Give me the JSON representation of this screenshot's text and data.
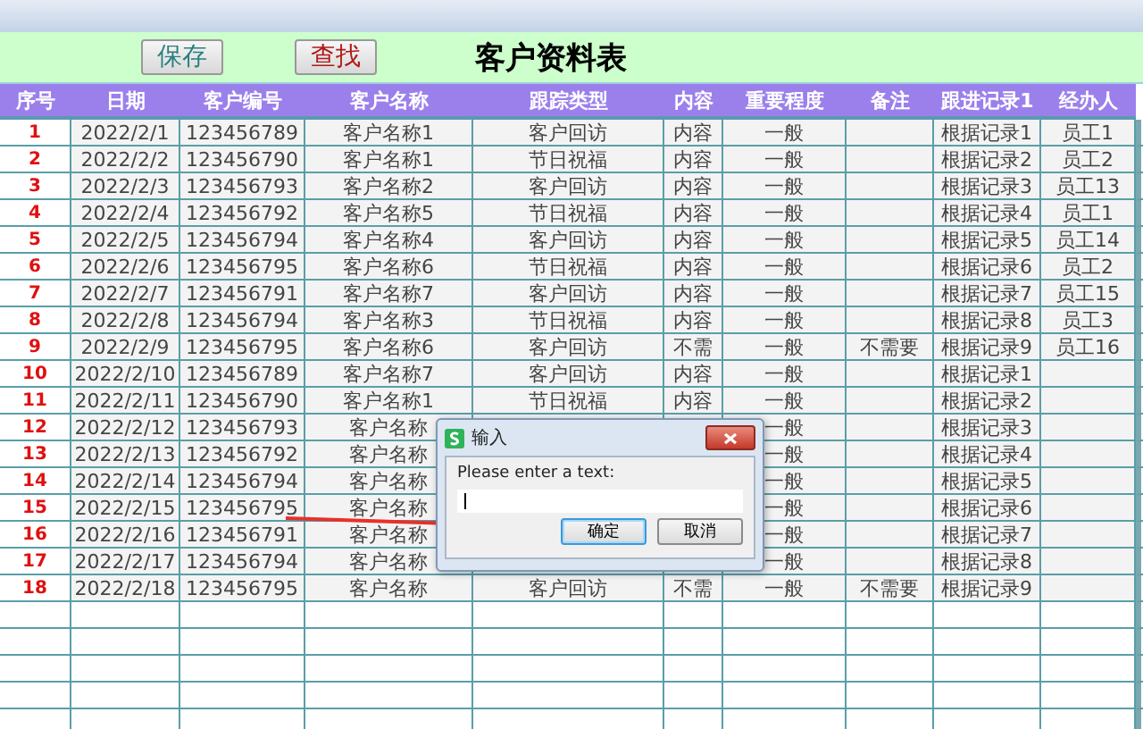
{
  "toolbar": {
    "buttons": [
      {
        "label": "保存",
        "kind": "save"
      },
      {
        "label": "查找",
        "kind": "find"
      }
    ],
    "title": "客户资料表"
  },
  "table": {
    "columns": [
      "序号",
      "日期",
      "客户编号",
      "客户名称",
      "跟踪类型",
      "内容",
      "重要程度",
      "备注",
      "跟进记录1",
      "经办人"
    ],
    "rows": [
      [
        "1",
        "2022/2/1",
        "123456789",
        "客户名称1",
        "客户回访",
        "内容",
        "一般",
        "",
        "根据记录1",
        "员工1"
      ],
      [
        "2",
        "2022/2/2",
        "123456790",
        "客户名称1",
        "节日祝福",
        "内容",
        "一般",
        "",
        "根据记录2",
        "员工2"
      ],
      [
        "3",
        "2022/2/3",
        "123456793",
        "客户名称2",
        "客户回访",
        "内容",
        "一般",
        "",
        "根据记录3",
        "员工13"
      ],
      [
        "4",
        "2022/2/4",
        "123456792",
        "客户名称5",
        "节日祝福",
        "内容",
        "一般",
        "",
        "根据记录4",
        "员工1"
      ],
      [
        "5",
        "2022/2/5",
        "123456794",
        "客户名称4",
        "客户回访",
        "内容",
        "一般",
        "",
        "根据记录5",
        "员工14"
      ],
      [
        "6",
        "2022/2/6",
        "123456795",
        "客户名称6",
        "节日祝福",
        "内容",
        "一般",
        "",
        "根据记录6",
        "员工2"
      ],
      [
        "7",
        "2022/2/7",
        "123456791",
        "客户名称7",
        "客户回访",
        "内容",
        "一般",
        "",
        "根据记录7",
        "员工15"
      ],
      [
        "8",
        "2022/2/8",
        "123456794",
        "客户名称3",
        "节日祝福",
        "内容",
        "一般",
        "",
        "根据记录8",
        "员工3"
      ],
      [
        "9",
        "2022/2/9",
        "123456795",
        "客户名称6",
        "客户回访",
        "不需",
        "一般",
        "不需要",
        "根据记录9",
        "员工16"
      ],
      [
        "10",
        "2022/2/10",
        "123456789",
        "客户名称7",
        "客户回访",
        "内容",
        "一般",
        "",
        "根据记录1",
        ""
      ],
      [
        "11",
        "2022/2/11",
        "123456790",
        "客户名称1",
        "节日祝福",
        "内容",
        "一般",
        "",
        "根据记录2",
        ""
      ],
      [
        "12",
        "2022/2/12",
        "123456793",
        "客户名称",
        "",
        "",
        "一般",
        "",
        "根据记录3",
        ""
      ],
      [
        "13",
        "2022/2/13",
        "123456792",
        "客户名称",
        "",
        "",
        "一般",
        "",
        "根据记录4",
        ""
      ],
      [
        "14",
        "2022/2/14",
        "123456794",
        "客户名称",
        "",
        "",
        "一般",
        "",
        "根据记录5",
        ""
      ],
      [
        "15",
        "2022/2/15",
        "123456795",
        "客户名称",
        "",
        "",
        "一般",
        "",
        "根据记录6",
        ""
      ],
      [
        "16",
        "2022/2/16",
        "123456791",
        "客户名称",
        "",
        "",
        "一般",
        "",
        "根据记录7",
        ""
      ],
      [
        "17",
        "2022/2/17",
        "123456794",
        "客户名称",
        "",
        "",
        "一般",
        "",
        "根据记录8",
        ""
      ],
      [
        "18",
        "2022/2/18",
        "123456795",
        "客户名称",
        "客户回访",
        "不需",
        "一般",
        "不需要",
        "根据记录9",
        ""
      ]
    ]
  },
  "dialog": {
    "title": "输入",
    "prompt": "Please enter a text:",
    "buttons": [
      {
        "label": "确定",
        "selected": true
      },
      {
        "label": "取消",
        "selected": false
      }
    ]
  }
}
